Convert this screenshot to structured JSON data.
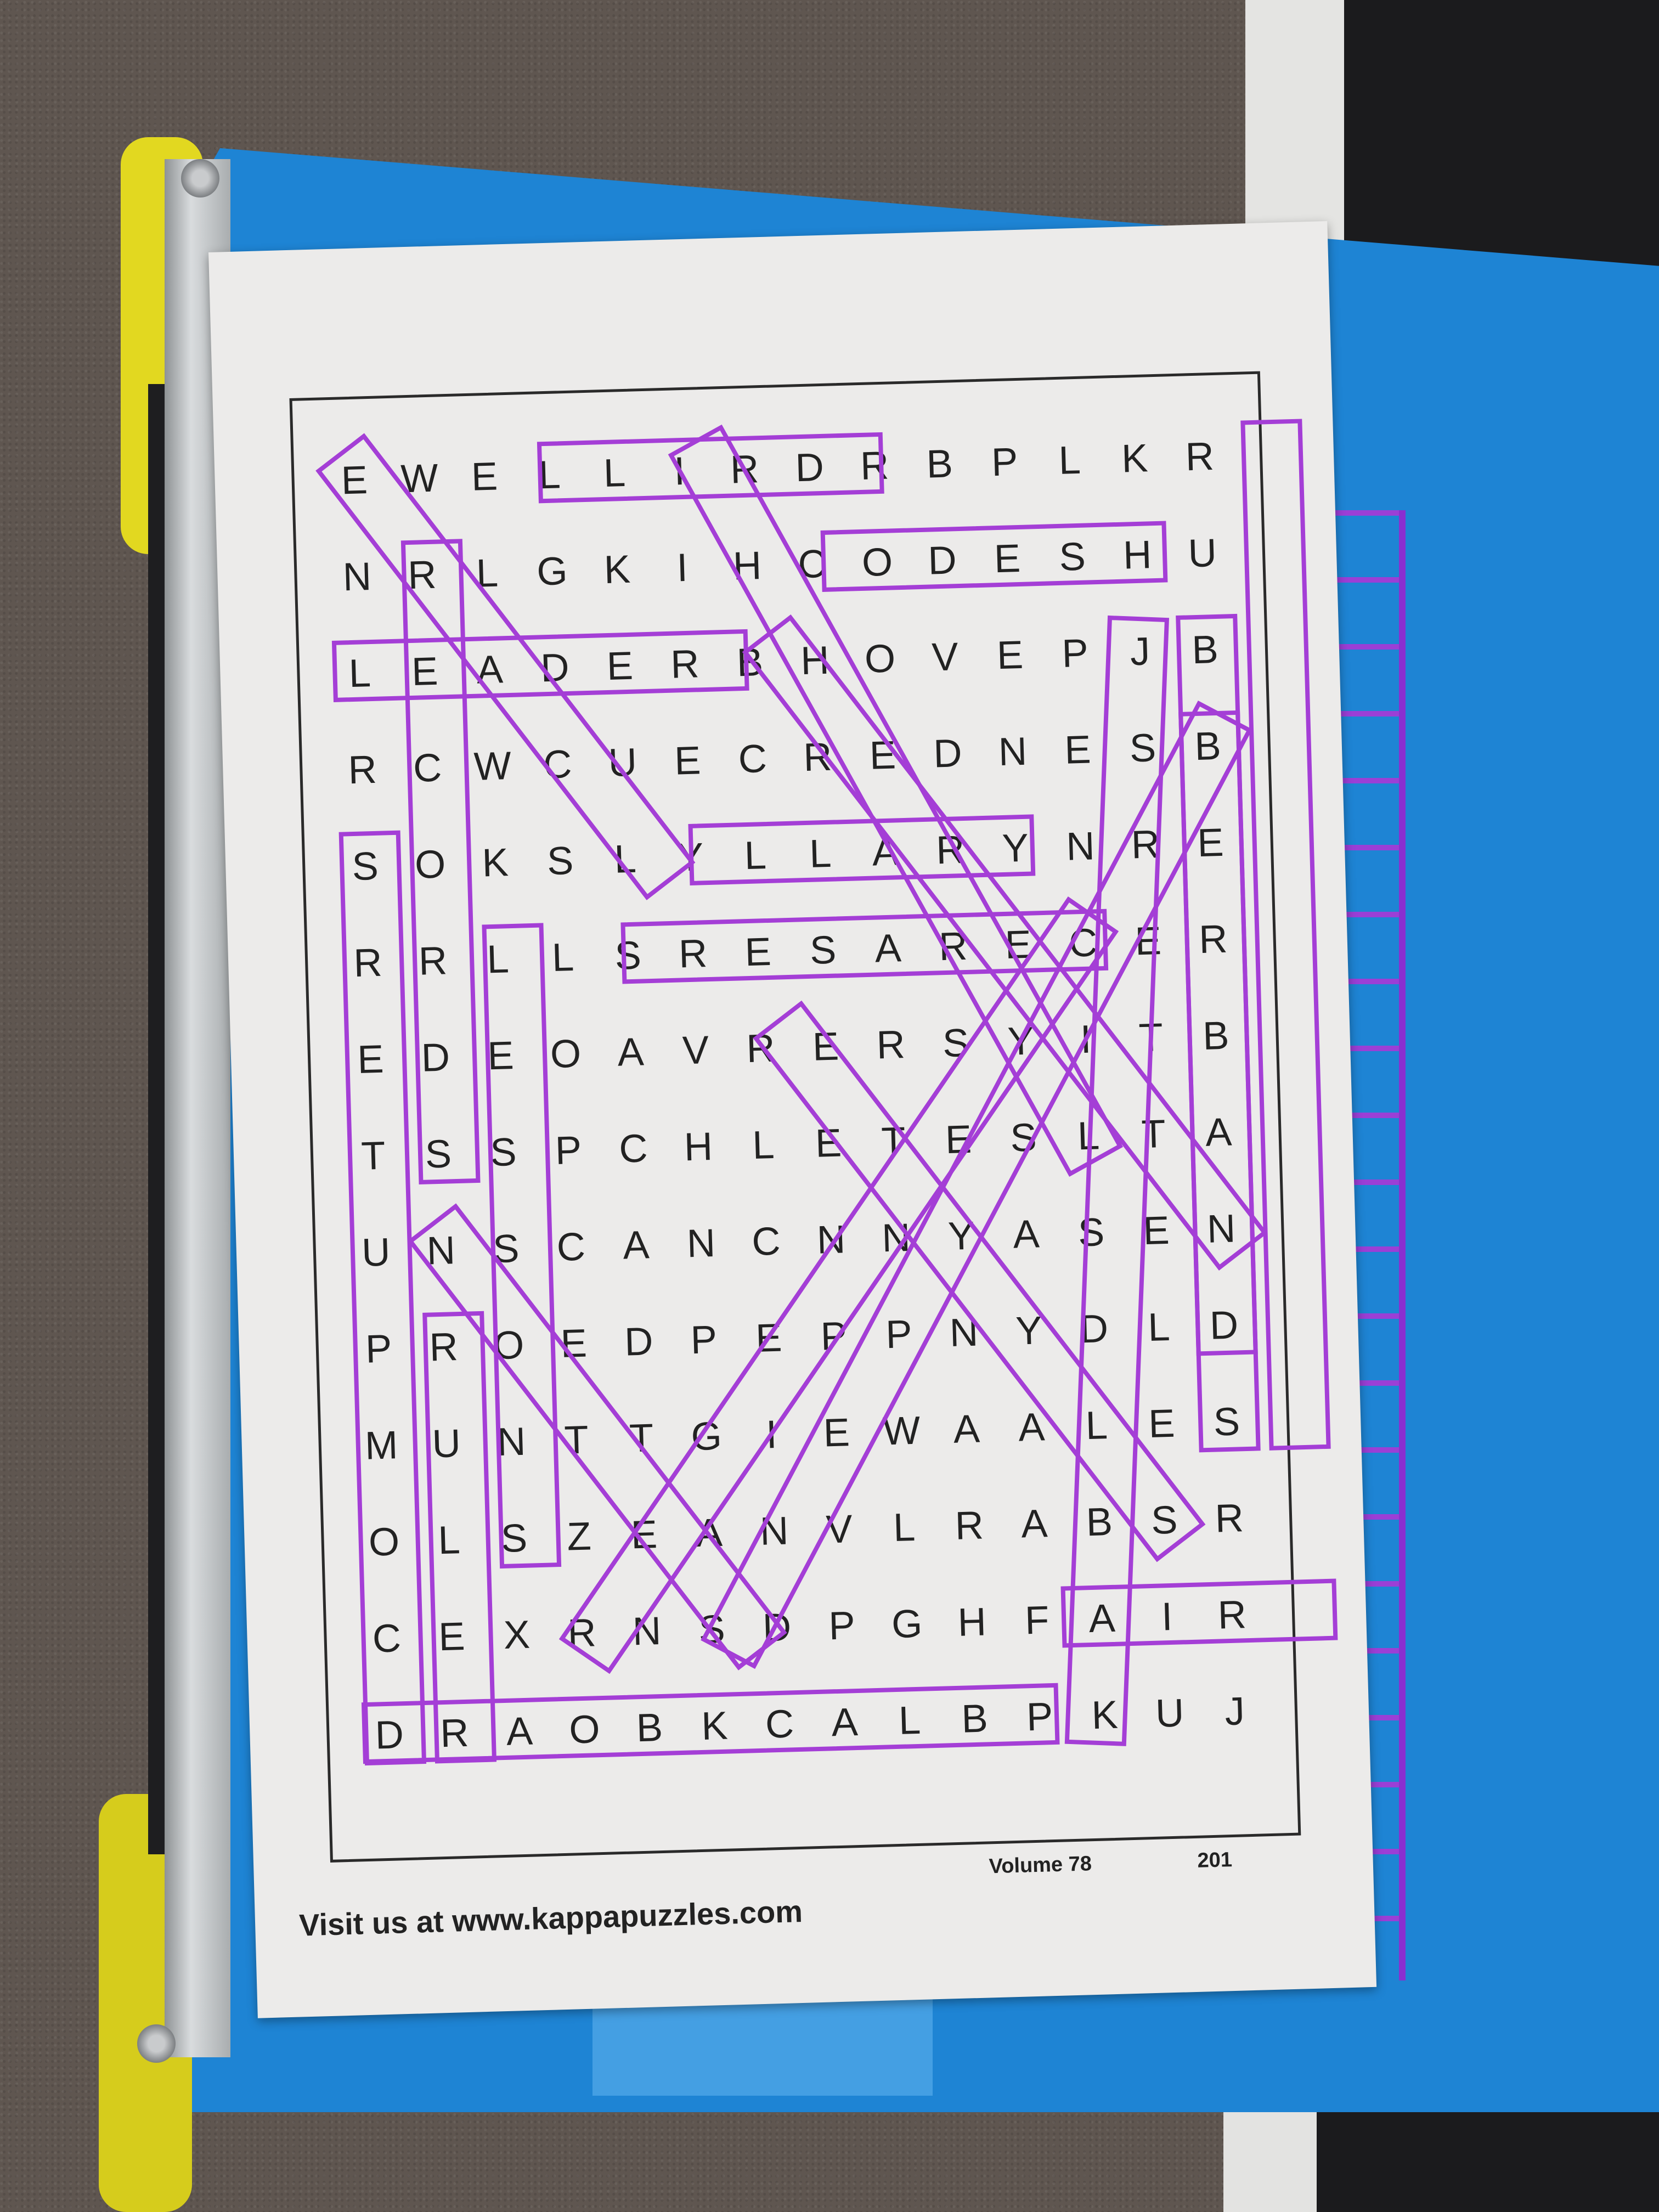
{
  "colors": {
    "tape_blue": "#1e84d4",
    "marker_purple": "#a43ed6",
    "paper": "#ecebea",
    "carpet": "#5f5650",
    "clamp_yellow": "#e2d820"
  },
  "puzzle": {
    "grid": [
      [
        "E",
        "W",
        "E",
        "L",
        "L",
        "I",
        "R",
        "D",
        "R",
        "B",
        "P",
        "L",
        "K",
        "R"
      ],
      [
        "N",
        "R",
        "L",
        "G",
        "K",
        "I",
        "H",
        "C",
        "O",
        "D",
        "E",
        "S",
        "H",
        "U"
      ],
      [
        "L",
        "E",
        "A",
        "D",
        "E",
        "R",
        "B",
        "H",
        "O",
        "V",
        "E",
        "P",
        "J",
        "B"
      ],
      [
        "R",
        "C",
        "W",
        "C",
        "U",
        "E",
        "C",
        "R",
        "E",
        "D",
        "N",
        "E",
        "S",
        "B"
      ],
      [
        "S",
        "O",
        "K",
        "S",
        "L",
        "Y",
        "L",
        "L",
        "A",
        "R",
        "Y",
        "N",
        "R",
        "E"
      ],
      [
        "R",
        "R",
        "L",
        "L",
        "S",
        "R",
        "E",
        "S",
        "A",
        "R",
        "E",
        "C",
        "E",
        "R"
      ],
      [
        "E",
        "D",
        "E",
        "O",
        "A",
        "V",
        "R",
        "E",
        "R",
        "S",
        "Y",
        "I",
        "T",
        "B"
      ],
      [
        "T",
        "S",
        "S",
        "P",
        "C",
        "H",
        "L",
        "E",
        "T",
        "E",
        "S",
        "L",
        "T",
        "A"
      ],
      [
        "U",
        "N",
        "S",
        "C",
        "A",
        "N",
        "C",
        "N",
        "N",
        "Y",
        "A",
        "S",
        "E",
        "N"
      ],
      [
        "P",
        "R",
        "O",
        "E",
        "D",
        "P",
        "E",
        "P",
        "P",
        "N",
        "Y",
        "D",
        "L",
        "D"
      ],
      [
        "M",
        "U",
        "N",
        "T",
        "T",
        "G",
        "I",
        "E",
        "W",
        "A",
        "A",
        "L",
        "E",
        "S"
      ],
      [
        "O",
        "L",
        "S",
        "Z",
        "E",
        "A",
        "N",
        "V",
        "L",
        "R",
        "A",
        "B",
        "S",
        "R"
      ],
      [
        "C",
        "E",
        "X",
        "R",
        "N",
        "S",
        "D",
        "P",
        "G",
        "H",
        "F",
        "A",
        "I",
        "R"
      ],
      [
        "D",
        "R",
        "A",
        "O",
        "B",
        "K",
        "C",
        "A",
        "L",
        "B",
        "P",
        "K",
        "U",
        "J"
      ]
    ],
    "footer_url": "Visit us at www.kappapuzzles.com",
    "volume_label": "Volume 78",
    "page_number": "201"
  }
}
